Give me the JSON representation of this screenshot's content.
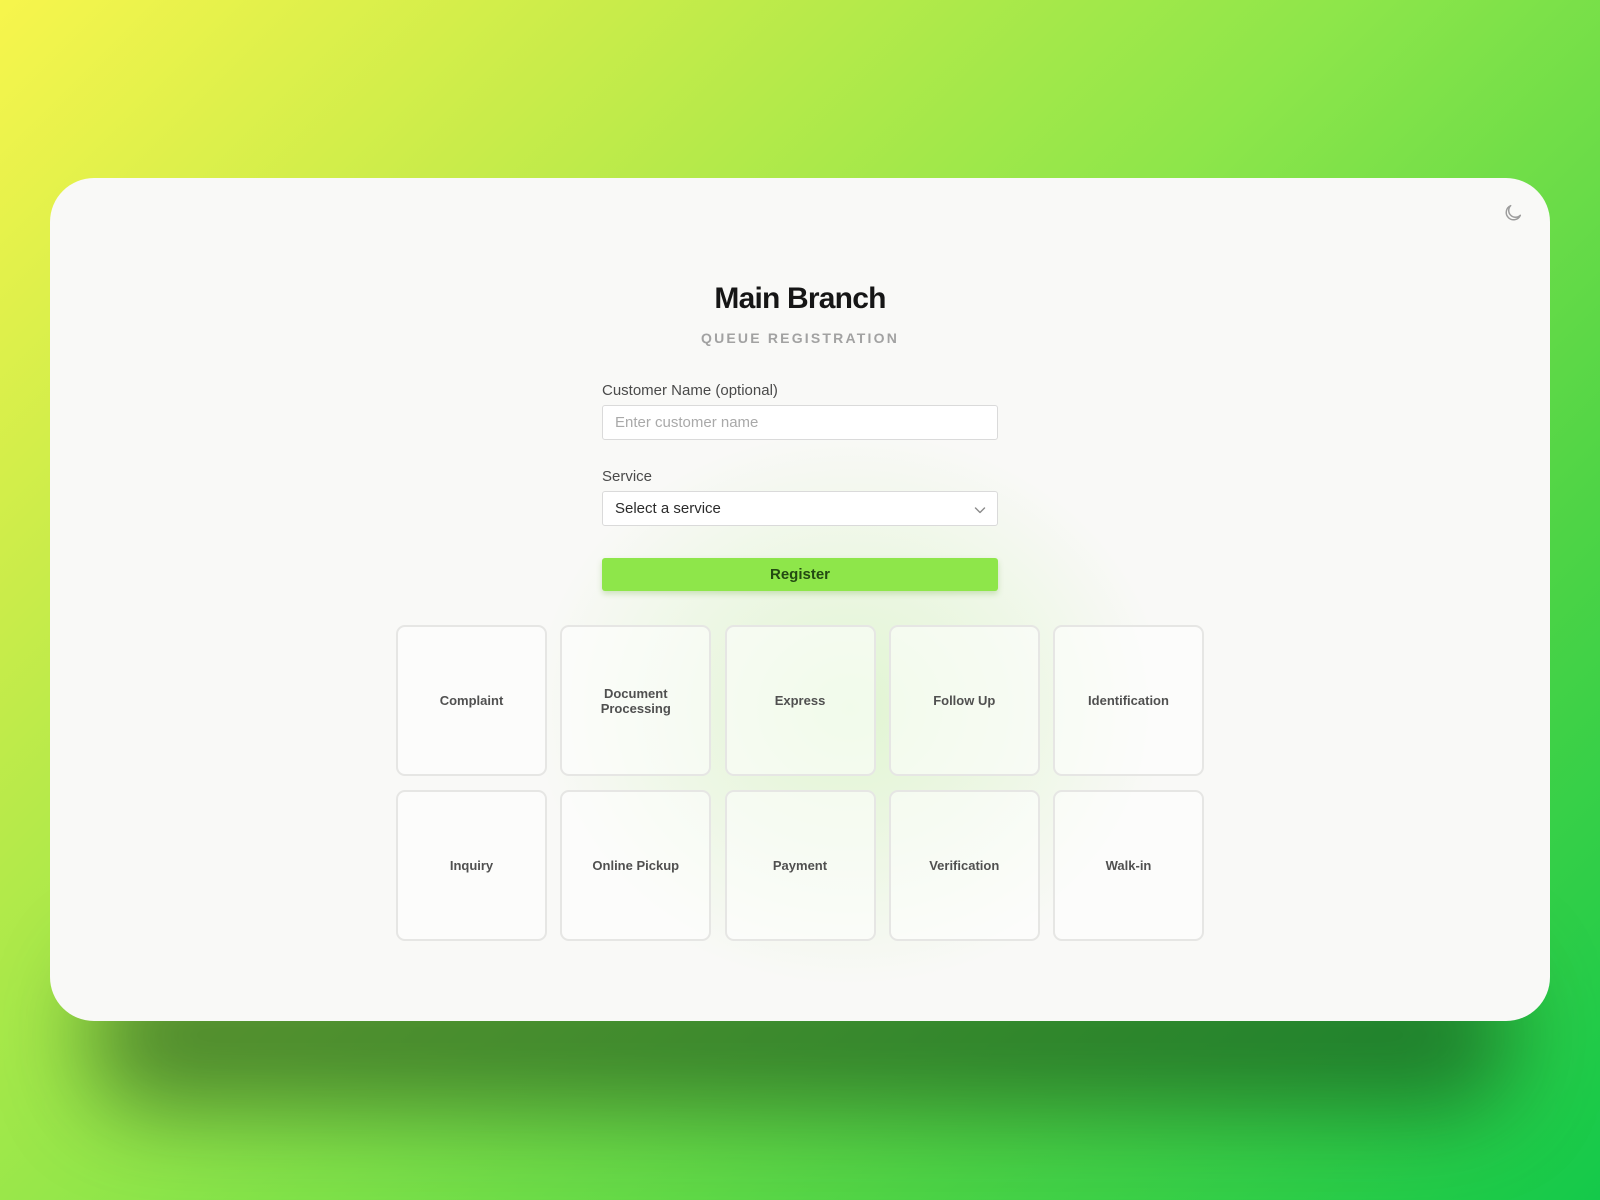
{
  "window": {
    "title": "Main Branch",
    "subtitle": "QUEUE REGISTRATION"
  },
  "theme_toggle": {
    "icon": "moon-icon"
  },
  "form": {
    "name_label": "Customer Name (optional)",
    "name_placeholder": "Enter customer name",
    "name_value": "",
    "service_label": "Service",
    "service_selected": "Select a service",
    "register_label": "Register"
  },
  "services": [
    "Complaint",
    "Document Processing",
    "Express",
    "Follow Up",
    "Identification",
    "Inquiry",
    "Online Pickup",
    "Payment",
    "Verification",
    "Walk-in"
  ],
  "colors": {
    "accent": "#8ee64a",
    "background_start": "#f7f54c",
    "background_end": "#14c94a",
    "panel": "#f9f9f7"
  }
}
